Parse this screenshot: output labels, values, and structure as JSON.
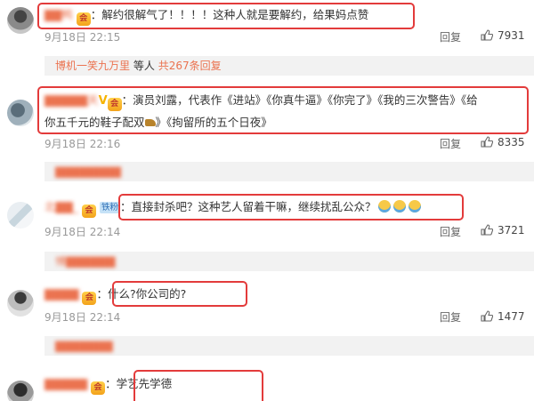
{
  "comments": [
    {
      "username": "▇▇鸭",
      "text": "：解约很解气了！！！！这种人就是要解约，给果妈点赞",
      "time": "9月18日 22:15",
      "reply_label": "回复",
      "likes": "7931",
      "subreply": {
        "name": "博机一笑九万里",
        "middle": "等人",
        "count": "共267条回复"
      }
    },
    {
      "username": "▇▇▇▇▇天",
      "text_line1": "：演员刘露，代表作《进站》《你真牛逼》《你完了》《我的三次警告》《给",
      "text_line2": "你五千元的鞋子配双",
      "text_line2b": "》《拘留所的五个日夜》",
      "time": "9月18日 22:16",
      "reply_label": "回复",
      "likes": "8335",
      "subreply": {
        "name": "▇▇▇▇▇▇▇▇"
      }
    },
    {
      "username": "北▇▇_",
      "badge": "铁粉",
      "text": "：直接封杀吧？这种艺人留着干嘛，继续扰乱公众？",
      "time": "9月18日 22:14",
      "reply_label": "回复",
      "likes": "3721",
      "subreply": {
        "name": "愽▇▇▇▇▇▇"
      }
    },
    {
      "username": "▇▇▇▇",
      "text": "：什么?你公司的?",
      "time": "9月18日 22:14",
      "reply_label": "回复",
      "likes": "1477",
      "subreply": {
        "name": "▇▇▇▇▇▇▇"
      }
    },
    {
      "username": "▇▇▇▇▇",
      "text": "：学艺先学德"
    }
  ],
  "icons": {
    "like": "thumbs-up-icon",
    "vip": "vip-crown-badge-icon",
    "verified": "verified-v-icon"
  },
  "colors": {
    "username": "#eb7350",
    "highlight_box": "#e33b3b",
    "meta": "#999999",
    "subreply_bg": "#f2f2f2"
  }
}
